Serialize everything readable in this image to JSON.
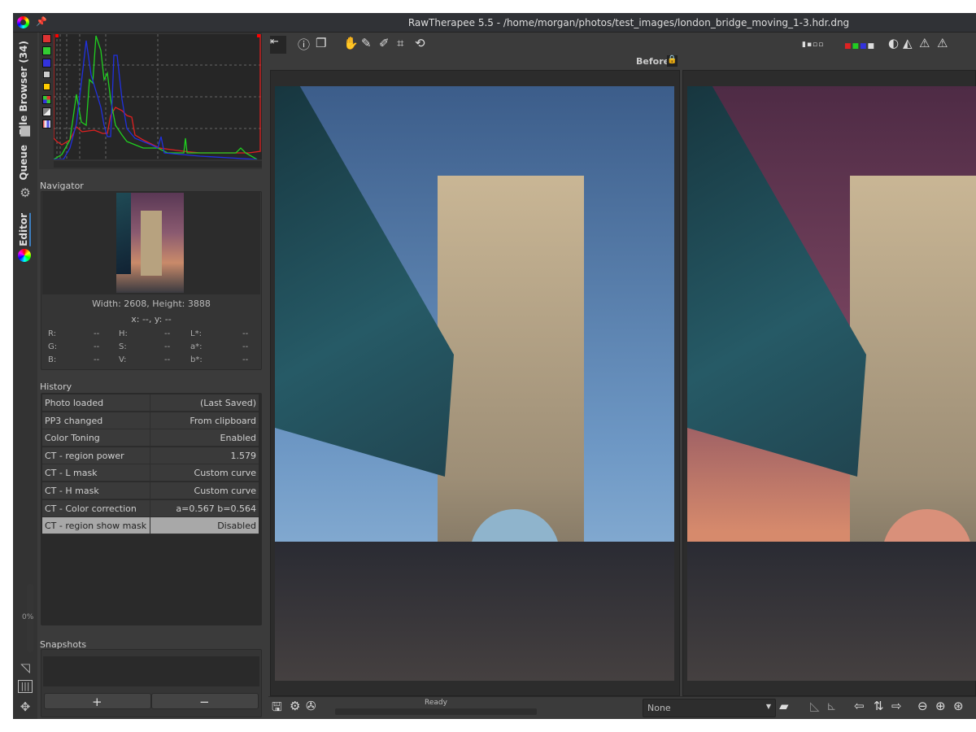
{
  "window": {
    "title": "RawTherapee 5.5 - /home/morgan/photos/test_images/london_bridge_moving_1-3.hdr.dng"
  },
  "tabs": {
    "file_browser": "File Browser (34)",
    "queue": "Queue",
    "editor": "Editor",
    "progress": "0%"
  },
  "navigator": {
    "label": "Navigator",
    "size": "Width: 2608, Height: 3888",
    "coords": "x: --, y: --",
    "values": [
      {
        "k": "R:",
        "v": "--"
      },
      {
        "k": "G:",
        "v": "--"
      },
      {
        "k": "B:",
        "v": "--"
      },
      {
        "k": "H:",
        "v": "--"
      },
      {
        "k": "S:",
        "v": "--"
      },
      {
        "k": "V:",
        "v": "--"
      },
      {
        "k": "L*:",
        "v": "--"
      },
      {
        "k": "a*:",
        "v": "--"
      },
      {
        "k": "b*:",
        "v": "--"
      }
    ]
  },
  "history": {
    "label": "History",
    "rows": [
      {
        "name": "Photo loaded",
        "value": "(Last Saved)"
      },
      {
        "name": "PP3 changed",
        "value": "From clipboard"
      },
      {
        "name": "Color Toning",
        "value": "Enabled"
      },
      {
        "name": "CT - region power",
        "value": "1.579"
      },
      {
        "name": "CT - L mask",
        "value": "Custom curve"
      },
      {
        "name": "CT - H mask",
        "value": "Custom curve"
      },
      {
        "name": "CT - Color correction",
        "value": "a=0.567 b=0.564"
      },
      {
        "name": "CT - region show mask",
        "value": "Disabled"
      }
    ],
    "selected": 7
  },
  "snapshots": {
    "label": "Snapshots",
    "add": "+",
    "remove": "−"
  },
  "preview": {
    "before_label": "Before"
  },
  "status": {
    "text": "Ready",
    "progress": 0
  },
  "bottom": {
    "profile_select": "None"
  },
  "colors": {
    "accent": "#3d7fc1",
    "histogram_red": "#e02020",
    "histogram_green": "#20d020",
    "histogram_blue": "#2030e0"
  }
}
